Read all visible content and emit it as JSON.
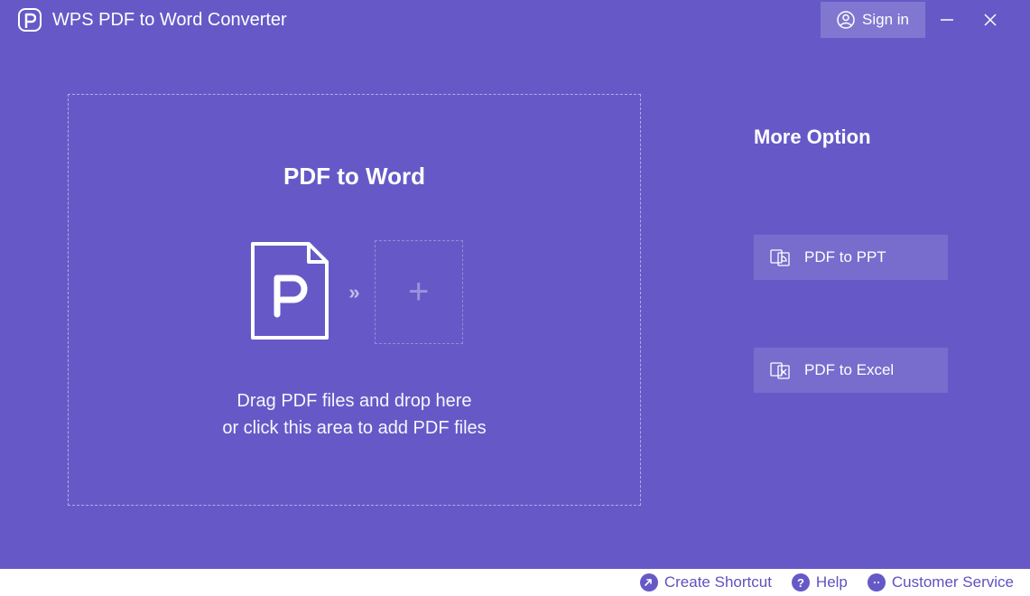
{
  "titlebar": {
    "app_title": "WPS PDF to Word Converter",
    "signin_label": "Sign in"
  },
  "dropzone": {
    "title": "PDF to Word",
    "instruction_line1": "Drag PDF files and drop here",
    "instruction_line2": "or click this area to add PDF files"
  },
  "sidebar": {
    "title": "More Option",
    "options": [
      {
        "label": "PDF to PPT"
      },
      {
        "label": "PDF to Excel"
      }
    ]
  },
  "footer": {
    "shortcut": "Create Shortcut",
    "help": "Help",
    "customer_service": "Customer Service"
  }
}
